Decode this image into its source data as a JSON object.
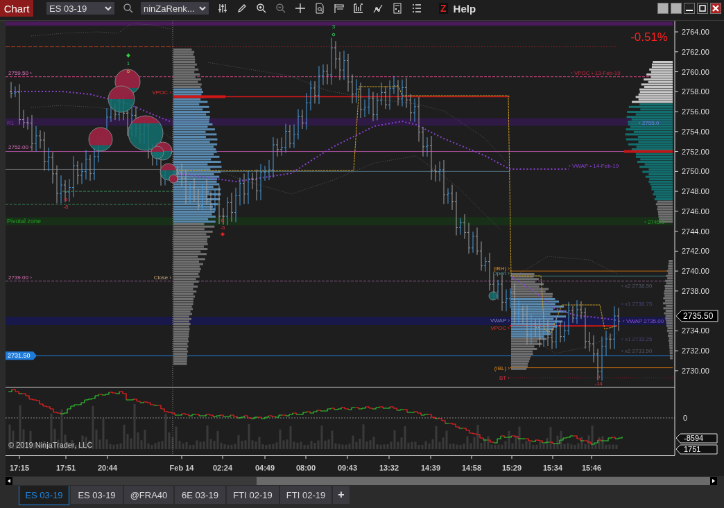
{
  "toolbar": {
    "title": "Chart",
    "instrument": "ES 03-19",
    "bar_type": "ninZaRenk...",
    "z_label": "Z",
    "help": "Help"
  },
  "chart": {
    "change": "-0.51%",
    "current_price": "2735.50",
    "marker_price": "2731.50",
    "pivot_zone": "Pivotal zone",
    "price_axis": [
      "2764.00",
      "2762.00",
      "2760.00",
      "2758.00",
      "2756.00",
      "2754.00",
      "2752.00",
      "2750.00",
      "2748.00",
      "2746.00",
      "2744.00",
      "2742.00",
      "2740.00",
      "2738.00",
      "2734.00",
      "2732.00",
      "2730.00"
    ],
    "labels": [
      {
        "text": "2759.50 ›"
      },
      {
        "text": "‹ VPOC • 13-Feb-19"
      },
      {
        "text": "VPOC ›"
      },
      {
        "text": "R1"
      },
      {
        "text": "‹ 2755.0"
      },
      {
        "text": "2752.00 ›"
      },
      {
        "text": "‹ VWAP • 14-Feb-19"
      },
      {
        "text": "‹ 2745.0"
      },
      {
        "text": "(IBH) ›"
      },
      {
        "text": "Open ›"
      },
      {
        "text": "2739.00 ›"
      },
      {
        "text": "Close ›"
      },
      {
        "text": "‹ x2 2738.50"
      },
      {
        "text": "‹ x1 2736.75"
      },
      {
        "text": "VWAP ›"
      },
      {
        "text": "‹ VWAP 2735.00"
      },
      {
        "text": "VPOC ›"
      },
      {
        "text": "‹ x1 2733.25"
      },
      {
        "text": "‹ x2 2731.50"
      },
      {
        "text": "(IBL) ›"
      },
      {
        "text": "BT ›"
      }
    ],
    "signal_counts": [
      "3",
      "1",
      "-8",
      "-6",
      "-14"
    ]
  },
  "indicator": {
    "zero": "0",
    "values": [
      "-8594",
      "1751"
    ],
    "copyright": "© 2019 NinjaTrader, LLC"
  },
  "time_axis": [
    "17:15",
    "17:51",
    "20:44",
    "Feb 14",
    "02:24",
    "04:49",
    "08:00",
    "09:43",
    "13:32",
    "14:39",
    "14:58",
    "15:29",
    "15:34",
    "15:46"
  ],
  "tabs": [
    {
      "label": "ES 03-19",
      "selected": true
    },
    {
      "label": "ES 03-19",
      "selected": false
    },
    {
      "label": "@FRA40",
      "selected": false
    },
    {
      "label": "6E 03-19",
      "selected": false
    },
    {
      "label": "FTI 02-19",
      "selected": false
    },
    {
      "label": "FTI 02-19",
      "selected": false
    }
  ],
  "add_tab": "+"
}
